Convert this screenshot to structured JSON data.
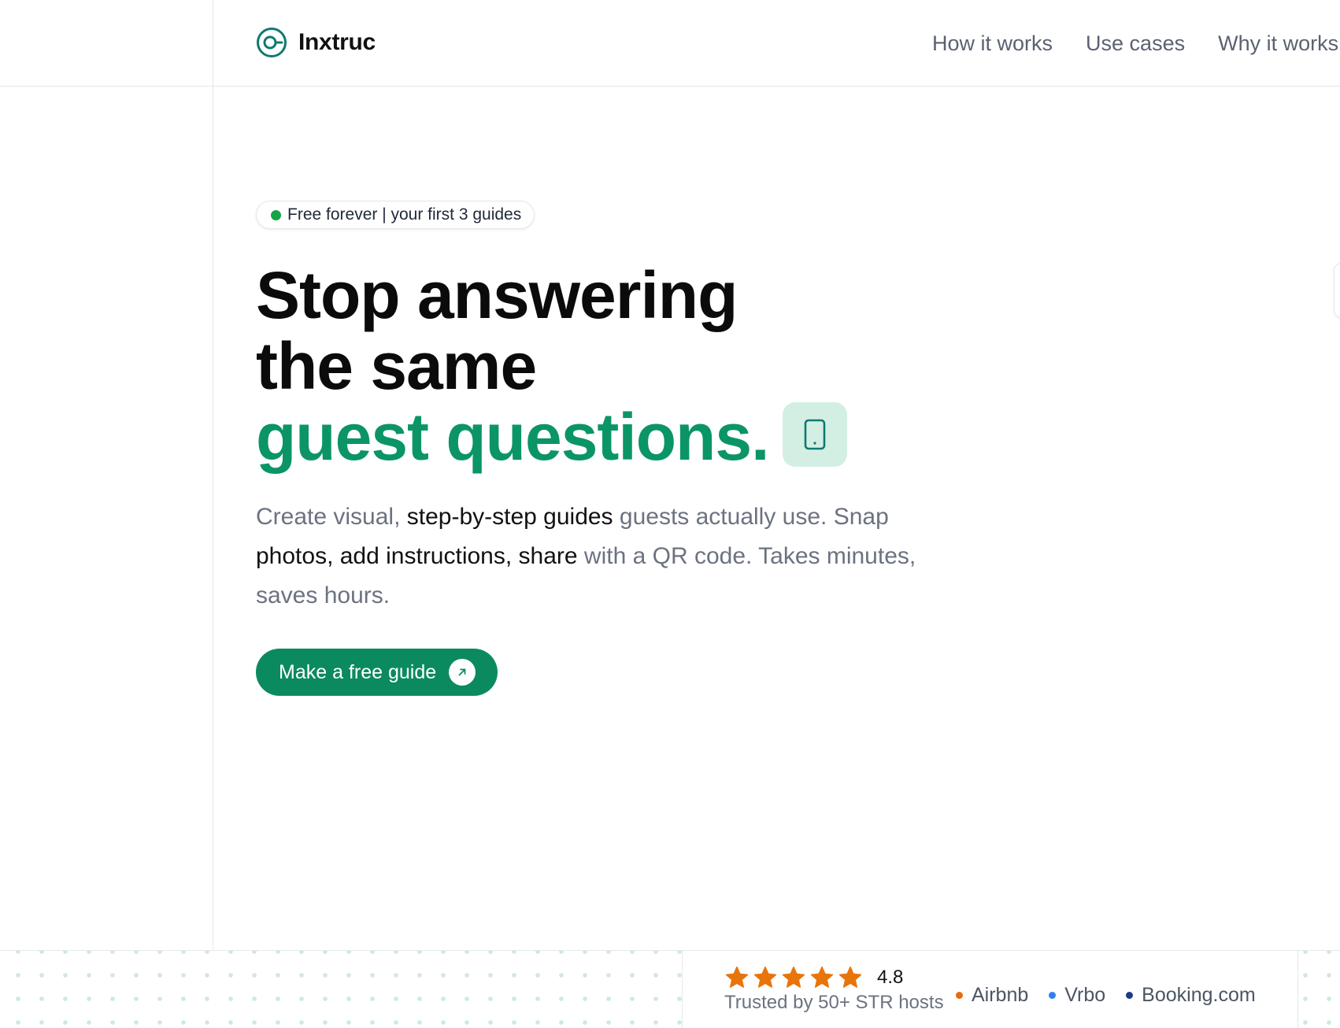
{
  "header": {
    "brand": "Inxtruc",
    "brand_color": "#0e7a6f",
    "logo_icon": "circle-logo-icon",
    "nav": [
      {
        "label": "How it works"
      },
      {
        "label": "Use cases"
      },
      {
        "label": "Why it works"
      }
    ]
  },
  "hero": {
    "badge": {
      "text": "Free forever | your first 3 guides",
      "dot_color": "#16a34a"
    },
    "headline": {
      "line1": "Stop answering",
      "line2": "the same",
      "line3": "guest questions."
    },
    "headline_icon": "phone-icon",
    "subheadline": {
      "p1": "Create visual, ",
      "p2": "step-by-step guides",
      "p3": " guests actually use. Snap ",
      "p4": "photos, add instructions, share",
      "p5": " with a QR code. Takes minutes, saves hours."
    },
    "cta": {
      "label": "Make a free guide",
      "icon": "arrow-up-right-icon"
    }
  },
  "trust": {
    "stars": 5,
    "rating": "4.8",
    "star_color": "#e8740c",
    "text": "Trusted by 50+ STR hosts",
    "platforms": [
      {
        "name": "Airbnb",
        "color": "#ea6a0c"
      },
      {
        "name": "Vrbo",
        "color": "#2f80ed"
      },
      {
        "name": "Booking.com",
        "color": "#1e3a8a"
      }
    ]
  },
  "colors": {
    "accent": "#0b9566",
    "cta": "#0b8a5f",
    "badge_bg": "#d3efe4"
  }
}
